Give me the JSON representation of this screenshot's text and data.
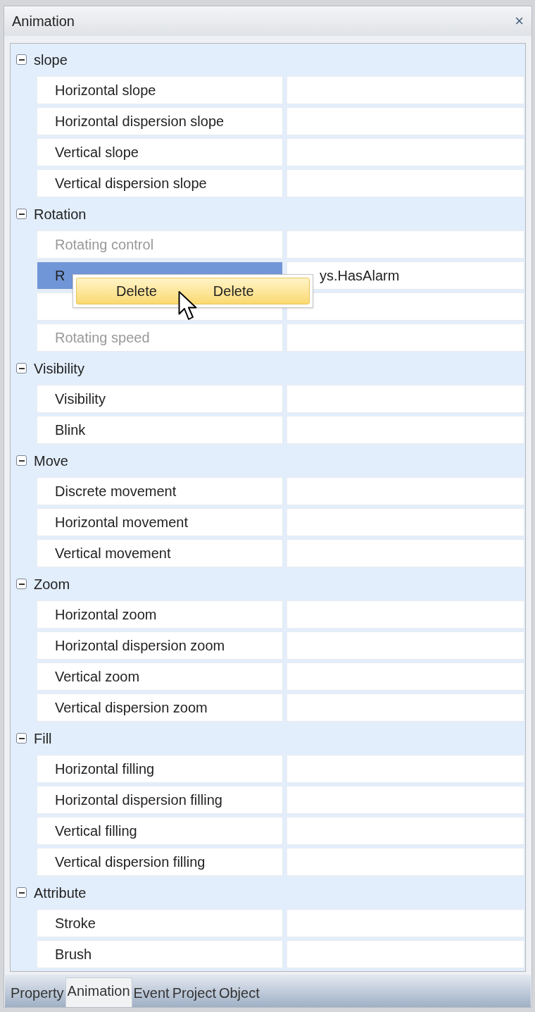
{
  "window": {
    "title": "Animation",
    "close": "×"
  },
  "groups": [
    {
      "name": "slope",
      "expanded": true,
      "items": [
        {
          "label": "Horizontal slope",
          "disabled": false,
          "selected": false
        },
        {
          "label": "Horizontal dispersion slope",
          "disabled": false,
          "selected": false
        },
        {
          "label": "Vertical slope",
          "disabled": false,
          "selected": false
        },
        {
          "label": "Vertical dispersion slope",
          "disabled": false,
          "selected": false
        }
      ]
    },
    {
      "name": "Rotation",
      "expanded": true,
      "items": [
        {
          "label": "Rotating control",
          "disabled": true,
          "selected": false
        },
        {
          "label": "R",
          "value": "ys.HasAlarm",
          "disabled": false,
          "selected": true
        },
        {
          "disabled": true,
          "selected": false
        },
        {
          "label": "Rotating speed",
          "disabled": true,
          "selected": false
        }
      ]
    },
    {
      "name": "Visibility",
      "expanded": true,
      "items": [
        {
          "label": "Visibility",
          "disabled": false,
          "selected": false
        },
        {
          "label": "Blink",
          "disabled": false,
          "selected": false
        }
      ]
    },
    {
      "name": "Move",
      "expanded": true,
      "items": [
        {
          "label": "Discrete movement",
          "disabled": false,
          "selected": false
        },
        {
          "label": "Horizontal movement",
          "disabled": false,
          "selected": false
        },
        {
          "label": "Vertical movement",
          "disabled": false,
          "selected": false
        }
      ]
    },
    {
      "name": "Zoom",
      "expanded": true,
      "items": [
        {
          "label": "Horizontal zoom",
          "disabled": false,
          "selected": false
        },
        {
          "label": "Horizontal dispersion zoom",
          "disabled": false,
          "selected": false
        },
        {
          "label": "Vertical zoom",
          "disabled": false,
          "selected": false
        },
        {
          "label": "Vertical dispersion zoom",
          "disabled": false,
          "selected": false
        }
      ]
    },
    {
      "name": "Fill",
      "expanded": true,
      "items": [
        {
          "label": "Horizontal filling",
          "disabled": false,
          "selected": false
        },
        {
          "label": "Horizontal dispersion filling",
          "disabled": false,
          "selected": false
        },
        {
          "label": "Vertical filling",
          "disabled": false,
          "selected": false
        },
        {
          "label": "Vertical dispersion filling",
          "disabled": false,
          "selected": false
        }
      ]
    },
    {
      "name": "Attribute",
      "expanded": true,
      "items": [
        {
          "label": "Stroke",
          "disabled": false,
          "selected": false
        },
        {
          "label": "Brush",
          "disabled": false,
          "selected": false
        }
      ]
    }
  ],
  "context_menu": {
    "items": [
      "Delete",
      "Delete"
    ]
  },
  "tabs": [
    {
      "label": "Property",
      "selected": false
    },
    {
      "label": "Animation",
      "selected": true
    },
    {
      "label": "Event",
      "selected": false
    },
    {
      "label": "Project",
      "selected": false
    },
    {
      "label": "Object",
      "selected": false
    }
  ]
}
